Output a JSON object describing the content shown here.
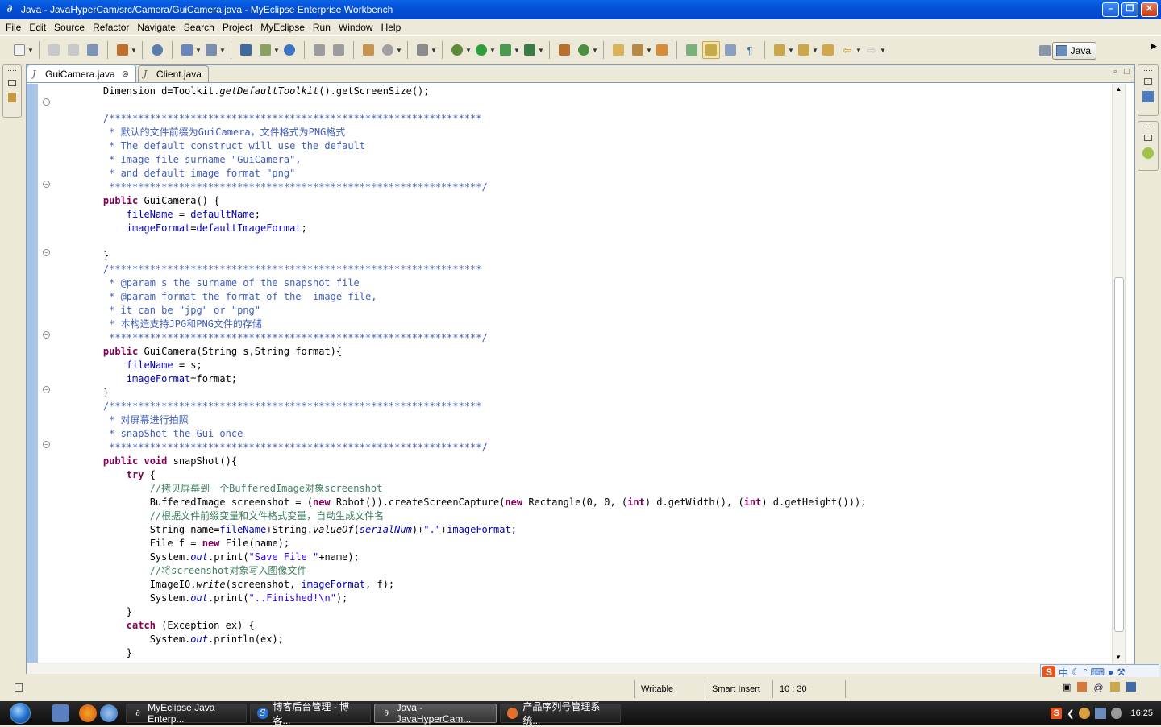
{
  "window": {
    "title": "Java - JavaHyperCam/src/Camera/GuiCamera.java - MyEclipse Enterprise Workbench"
  },
  "menu": [
    "File",
    "Edit",
    "Source",
    "Refactor",
    "Navigate",
    "Search",
    "Project",
    "MyEclipse",
    "Run",
    "Window",
    "Help"
  ],
  "perspective": {
    "label": "Java"
  },
  "tabs": [
    {
      "label": "GuiCamera.java",
      "active": true
    },
    {
      "label": "Client.java",
      "active": false
    }
  ],
  "code_lines": [
    [
      [
        "n",
        "    Dimension d=Toolkit."
      ],
      [
        "mi",
        "getDefaultToolkit"
      ],
      [
        "n",
        "().getScreenSize();"
      ]
    ],
    [],
    [
      [
        "c",
        "    /****************************************************************"
      ]
    ],
    [
      [
        "c",
        "     * 默认的文件前缀为GuiCamera，文件格式为PNG格式"
      ]
    ],
    [
      [
        "c",
        "     * The default construct will use the default"
      ]
    ],
    [
      [
        "c",
        "     * Image file surname \"GuiCamera\","
      ]
    ],
    [
      [
        "c",
        "     * and default image format \"png\""
      ]
    ],
    [
      [
        "c",
        "     ****************************************************************/"
      ]
    ],
    [
      [
        "k",
        "    public"
      ],
      [
        "n",
        " GuiCamera() {"
      ]
    ],
    [
      [
        "n",
        "        "
      ],
      [
        "f",
        "fileName"
      ],
      [
        "n",
        " = "
      ],
      [
        "f",
        "defaultName"
      ],
      [
        "n",
        ";"
      ]
    ],
    [
      [
        "n",
        "        "
      ],
      [
        "f",
        "imageFormat"
      ],
      [
        "n",
        "="
      ],
      [
        "f",
        "defaultImageFormat"
      ],
      [
        "n",
        ";"
      ]
    ],
    [],
    [
      [
        "n",
        "    }"
      ]
    ],
    [
      [
        "c",
        "    /****************************************************************"
      ]
    ],
    [
      [
        "c",
        "     * @param s the surname of the snapshot file"
      ]
    ],
    [
      [
        "c",
        "     * @param format the format of the  image file,"
      ]
    ],
    [
      [
        "c",
        "     * it can be \"jpg\" or \"png\""
      ]
    ],
    [
      [
        "c",
        "     * 本构造支持JPG和PNG文件的存储"
      ]
    ],
    [
      [
        "c",
        "     ****************************************************************/"
      ]
    ],
    [
      [
        "k",
        "    public"
      ],
      [
        "n",
        " GuiCamera(String s,String format){"
      ]
    ],
    [
      [
        "n",
        "        "
      ],
      [
        "f",
        "fileName"
      ],
      [
        "n",
        " = s;"
      ]
    ],
    [
      [
        "n",
        "        "
      ],
      [
        "f",
        "imageFormat"
      ],
      [
        "n",
        "=format;"
      ]
    ],
    [
      [
        "n",
        "    }"
      ]
    ],
    [
      [
        "c",
        "    /****************************************************************"
      ]
    ],
    [
      [
        "c",
        "     * 对屏幕进行拍照"
      ]
    ],
    [
      [
        "c",
        "     * snapShot the Gui once"
      ]
    ],
    [
      [
        "c",
        "     ****************************************************************/"
      ]
    ],
    [
      [
        "k",
        "    public void"
      ],
      [
        "n",
        " snapShot(){"
      ]
    ],
    [
      [
        "k",
        "        try"
      ],
      [
        "n",
        " {"
      ]
    ],
    [
      [
        "l",
        "            //拷贝屏幕到一个BufferedImage对象screenshot"
      ]
    ],
    [
      [
        "n",
        "            BufferedImage screenshot = ("
      ],
      [
        "k",
        "new"
      ],
      [
        "n",
        " Robot()).createScreenCapture("
      ],
      [
        "k",
        "new"
      ],
      [
        "n",
        " Rectangle(0, 0, ("
      ],
      [
        "k",
        "int"
      ],
      [
        "n",
        ") d.getWidth(), ("
      ],
      [
        "k",
        "int"
      ],
      [
        "n",
        ") d.getHeight()));"
      ]
    ],
    [
      [
        "l",
        "            //根据文件前缀变量和文件格式变量，自动生成文件名"
      ]
    ],
    [
      [
        "n",
        "            String name="
      ],
      [
        "f",
        "fileName"
      ],
      [
        "n",
        "+String."
      ],
      [
        "mi",
        "valueOf"
      ],
      [
        "n",
        "("
      ],
      [
        "fi",
        "serialNum"
      ],
      [
        "n",
        ")+"
      ],
      [
        "s",
        "\".\""
      ],
      [
        "n",
        "+"
      ],
      [
        "f",
        "imageFormat"
      ],
      [
        "n",
        ";"
      ]
    ],
    [
      [
        "n",
        "            File f = "
      ],
      [
        "k",
        "new"
      ],
      [
        "n",
        " File(name);"
      ]
    ],
    [
      [
        "n",
        "            System."
      ],
      [
        "fi",
        "out"
      ],
      [
        "n",
        ".print("
      ],
      [
        "s",
        "\"Save File \""
      ],
      [
        "n",
        "+name);"
      ]
    ],
    [
      [
        "l",
        "            //将screenshot对象写入图像文件"
      ]
    ],
    [
      [
        "n",
        "            ImageIO."
      ],
      [
        "mi",
        "write"
      ],
      [
        "n",
        "(screenshot, "
      ],
      [
        "f",
        "imageFormat"
      ],
      [
        "n",
        ", f);"
      ]
    ],
    [
      [
        "n",
        "            System."
      ],
      [
        "fi",
        "out"
      ],
      [
        "n",
        ".print("
      ],
      [
        "s",
        "\"..Finished!\\n\""
      ],
      [
        "n",
        ");"
      ]
    ],
    [
      [
        "n",
        "        }"
      ]
    ],
    [
      [
        "k",
        "        catch"
      ],
      [
        "n",
        " (Exception ex) {"
      ]
    ],
    [
      [
        "n",
        "            System."
      ],
      [
        "fi",
        "out"
      ],
      [
        "n",
        ".println(ex);"
      ]
    ],
    [
      [
        "n",
        "        }"
      ]
    ]
  ],
  "status": {
    "mode": "Writable",
    "insert": "Smart Insert",
    "position": "10 : 30"
  },
  "ime": {
    "label": "中"
  },
  "taskbar": {
    "tasks": [
      {
        "label": "MyEclipse Java Enterp...",
        "active": false
      },
      {
        "label": "博客后台管理 - 博客...",
        "active": false
      },
      {
        "label": "Java - JavaHyperCam...",
        "active": true
      },
      {
        "label": "产品序列号管理系统...",
        "active": false
      }
    ],
    "clock": "16:25"
  }
}
